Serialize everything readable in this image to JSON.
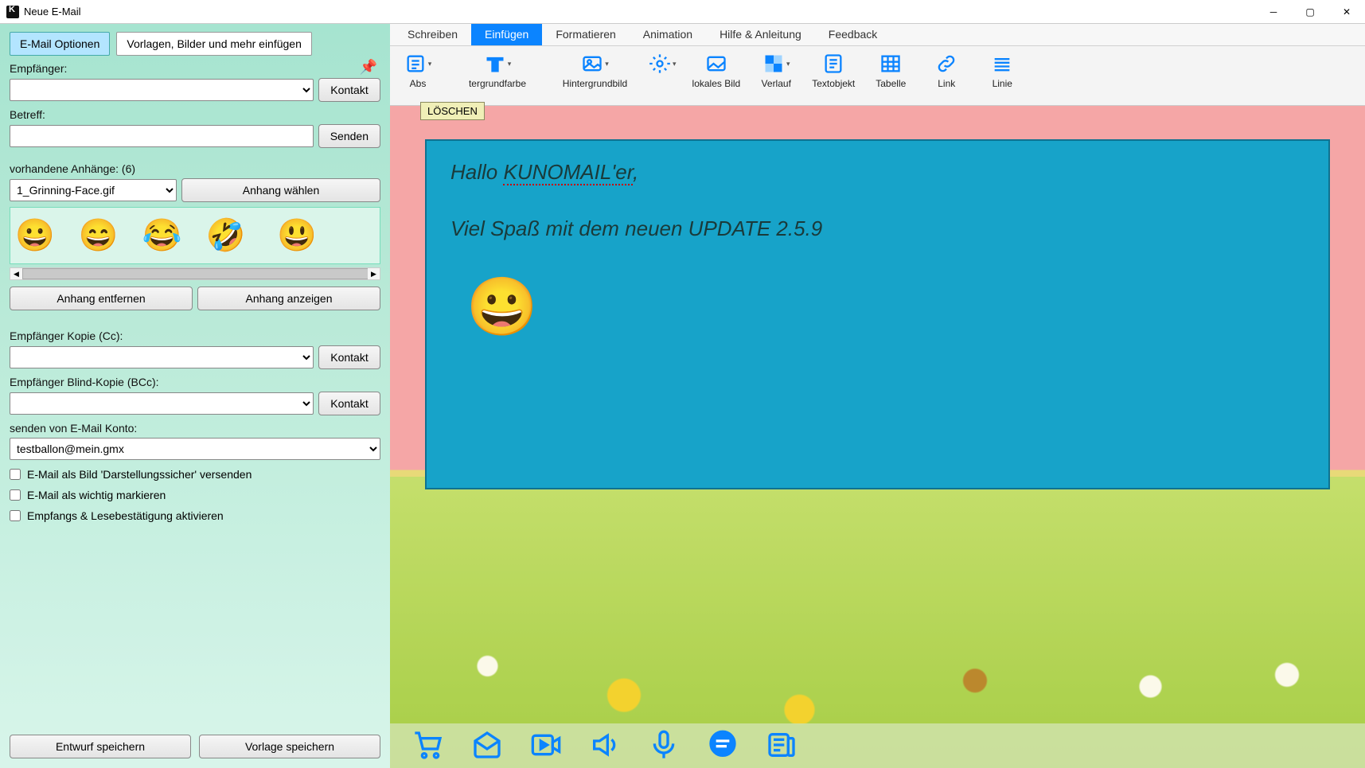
{
  "window": {
    "title": "Neue E-Mail"
  },
  "sidebar": {
    "tabs": {
      "options": "E-Mail Optionen",
      "templates": "Vorlagen, Bilder und mehr einfügen"
    },
    "recipient_label": "Empfänger:",
    "contact_btn": "Kontakt",
    "subject_label": "Betreff:",
    "send_btn": "Senden",
    "attachments_label": "vorhandene Anhänge: (6)",
    "attachment_selected": "1_Grinning-Face.gif",
    "choose_attachment_btn": "Anhang wählen",
    "remove_attachment_btn": "Anhang entfernen",
    "show_attachment_btn": "Anhang anzeigen",
    "cc_label": "Empfänger Kopie (Cc):",
    "bcc_label": "Empfänger Blind-Kopie (BCc):",
    "from_label": "senden von E-Mail Konto:",
    "from_value": "testballon@mein.gmx",
    "chk_image": "E-Mail als Bild 'Darstellungssicher' versenden",
    "chk_important": "E-Mail als wichtig markieren",
    "chk_receipt": "Empfangs & Lesebestätigung aktivieren",
    "save_draft_btn": "Entwurf speichern",
    "save_template_btn": "Vorlage speichern"
  },
  "ribbon": {
    "tabs": [
      "Schreiben",
      "Einfügen",
      "Formatieren",
      "Animation",
      "Hilfe & Anleitung",
      "Feedback"
    ],
    "active_index": 1,
    "items": [
      {
        "key": "abs",
        "label": "Abs"
      },
      {
        "key": "bgcolor",
        "label": "tergrundfarbe"
      },
      {
        "key": "bgimage",
        "label": "Hintergrundbild"
      },
      {
        "key": "localimg",
        "label": "lokales Bild"
      },
      {
        "key": "gradient",
        "label": "Verlauf"
      },
      {
        "key": "textobj",
        "label": "Textobjekt"
      },
      {
        "key": "table",
        "label": "Tabelle"
      },
      {
        "key": "link",
        "label": "Link"
      },
      {
        "key": "line",
        "label": "Linie"
      }
    ],
    "tooltip": "LÖSCHEN"
  },
  "editor": {
    "line1_a": "Hallo ",
    "line1_b": "KUNOMAIL'er",
    "line1_c": ",",
    "line2": "Viel Spaß mit dem neuen UPDATE 2.5.9"
  }
}
